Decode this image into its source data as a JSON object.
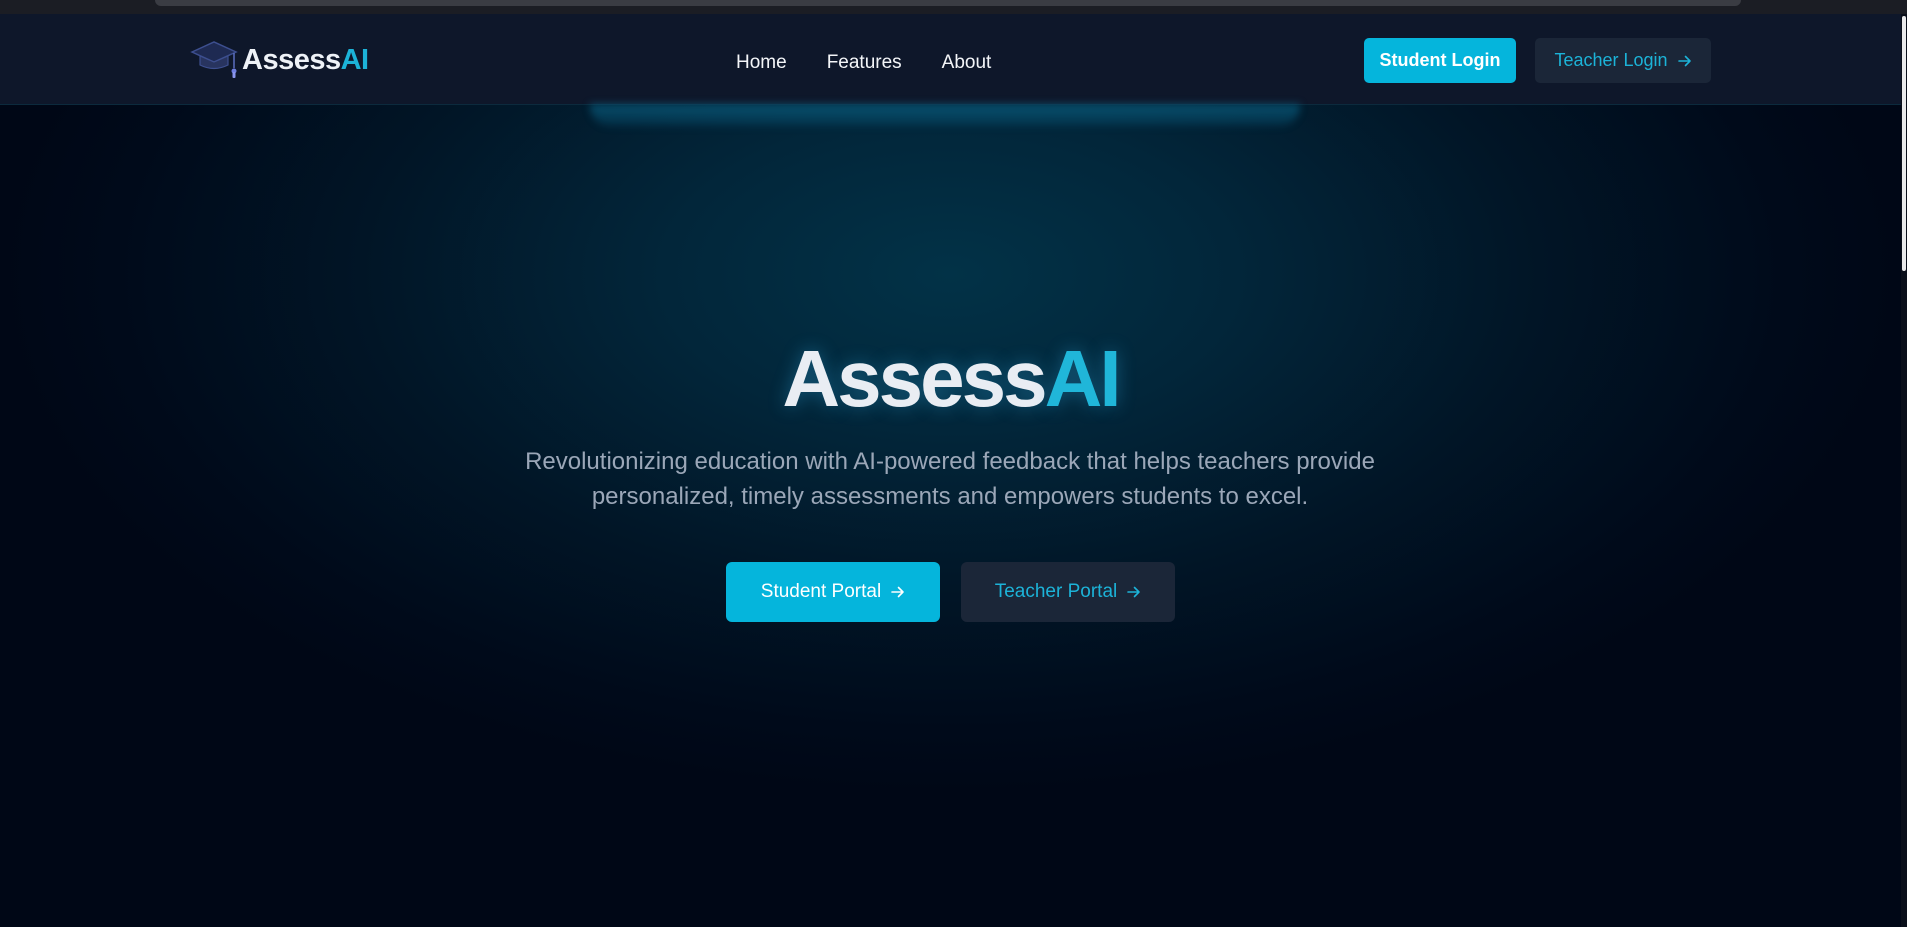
{
  "nav": {
    "brand": {
      "name_main": "Assess",
      "name_accent": "AI",
      "icon": "graduation-cap-icon"
    },
    "links": [
      {
        "label": "Home"
      },
      {
        "label": "Features"
      },
      {
        "label": "About"
      }
    ],
    "student_login_label": "Student Login",
    "teacher_login_label": "Teacher Login"
  },
  "hero": {
    "title_main": "Assess",
    "title_accent": "AI",
    "subtitle": "Revolutionizing education with AI-powered feedback that helps teachers provide personalized, timely assessments and empowers students to excel.",
    "student_portal_label": "Student Portal",
    "teacher_portal_label": "Teacher Portal"
  },
  "colors": {
    "accent": "#05b5dc",
    "nav_background": "#0e172a",
    "secondary_button": "#1b2638"
  },
  "icons": {
    "arrow": "arrow-right-icon"
  }
}
